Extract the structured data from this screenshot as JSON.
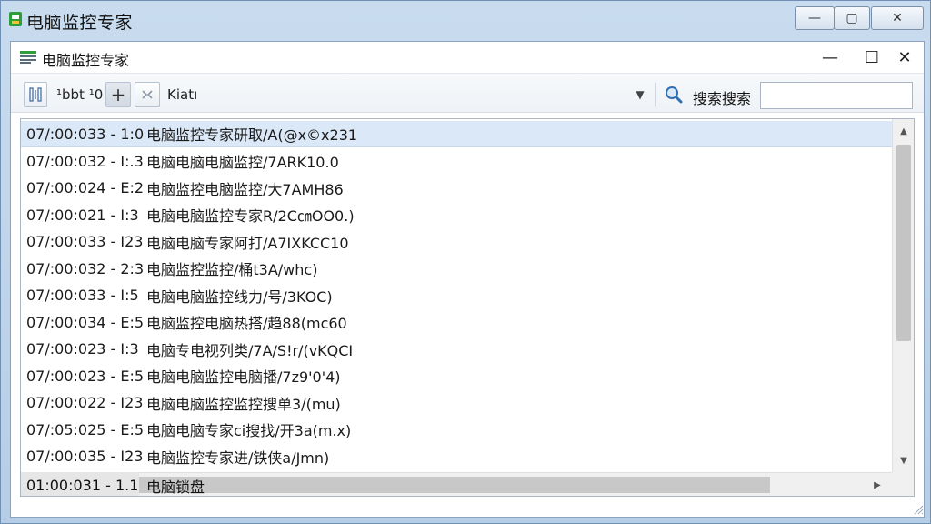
{
  "outer_window": {
    "title": "电脑监控专家",
    "minimize_glyph": "—",
    "maximize_glyph": "▢",
    "close_glyph": "✕"
  },
  "inner_window": {
    "title": "电脑监控专家",
    "minimize_glyph": "—",
    "maximize_glyph": "☐",
    "close_glyph": "✕"
  },
  "toolbar": {
    "column_icon": "column-layout-icon",
    "label_1": "¹bbt ¹0",
    "add_glyph": "+",
    "tool_icon": "wrench-icon",
    "label_2": "Kiatı",
    "dropdown_glyph": "▼",
    "search_label": "搜索搜索",
    "search_value": ""
  },
  "list": {
    "rows": [
      {
        "time": "07/:00:033 - 1:0",
        "desc": "电脑监控专家研取/A(@x©x231",
        "state": "selected"
      },
      {
        "time": "07/:00:032 - I:.3",
        "desc": "电脑电脑电脑监控/7ARK10.0",
        "state": "normal"
      },
      {
        "time": "07/:00:024 - E:2",
        "desc": "电脑监控电脑监控/大7AMH86",
        "state": "normal"
      },
      {
        "time": "07/:00:021 - I:3",
        "desc": "电脑电脑监控专家R/2C㎝OO0.)",
        "state": "normal"
      },
      {
        "time": "07/:00:033 - I23",
        "desc": "电脑电脑专家阿打/A7IXKCC10",
        "state": "normal"
      },
      {
        "time": "07/:00:032 - 2:3",
        "desc": "电脑监控监控/桶t3A/whc)",
        "state": "normal"
      },
      {
        "time": "07/:00:033 - I:5",
        "desc": "电脑电脑监控线力/号/3KOC)",
        "state": "normal"
      },
      {
        "time": "07/:00:034 - E:5",
        "desc": "电脑监控电脑热搭/趋88(mc60",
        "state": "normal"
      },
      {
        "time": "07/:00:023 - I:3",
        "desc": "电脑专电视列类/7A/S!r/(vKQCI",
        "state": "normal"
      },
      {
        "time": "07/:00:023 - E:5",
        "desc": "电脑电脑监控电脑播/7z9'0'4)",
        "state": "normal"
      },
      {
        "time": "07/:00:022 - I23",
        "desc": "电脑电脑监控监控搜单3/(mu)",
        "state": "normal"
      },
      {
        "time": "07/:05:025 - E:5",
        "desc": "电脑电脑专家ci搜找/开3a(m.x)",
        "state": "normal"
      },
      {
        "time": "07/:00:035 - I23",
        "desc": "电脑监控专家进/铁侠a/Jmn)",
        "state": "normal"
      },
      {
        "time": "01:00:031 - 1.1",
        "desc": "电脑锁盘",
        "state": "last"
      }
    ]
  },
  "scrollbars": {
    "up_glyph": "▲",
    "down_glyph": "▼",
    "right_glyph": "▶"
  },
  "colors": {
    "selected_row": "#dbe8f7",
    "frame": "#b9d1ea",
    "accent_green": "#2e9d3a"
  }
}
